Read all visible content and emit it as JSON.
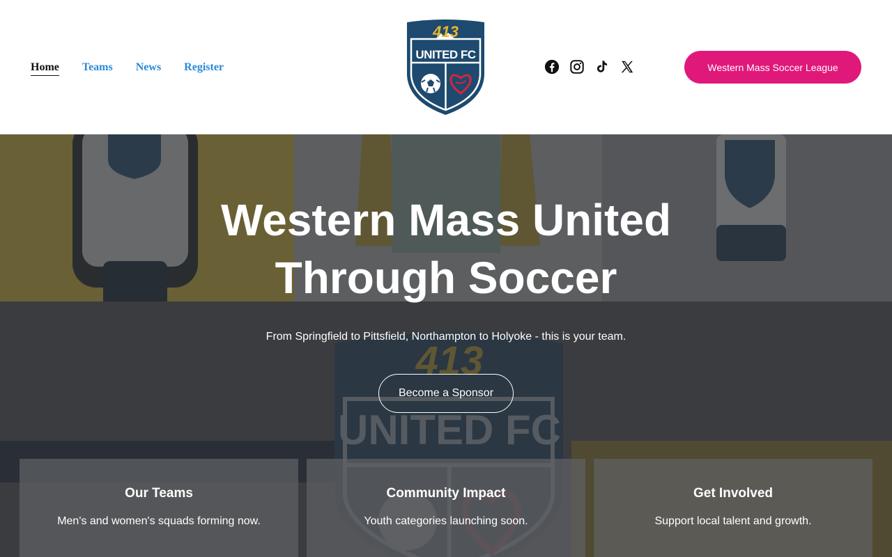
{
  "nav": {
    "items": [
      {
        "label": "Home",
        "active": true
      },
      {
        "label": "Teams",
        "active": false
      },
      {
        "label": "News",
        "active": false
      },
      {
        "label": "Register",
        "active": false
      }
    ]
  },
  "logo": {
    "top_text": "413",
    "main_text": "UNITED FC",
    "colors": {
      "navy": "#1d4a6e",
      "gold": "#e8b62c",
      "red": "#d9243b"
    }
  },
  "social": {
    "icons": [
      "facebook-icon",
      "instagram-icon",
      "tiktok-icon",
      "x-icon"
    ]
  },
  "header_cta": {
    "label": "Western Mass Soccer League",
    "color": "#e0187a"
  },
  "hero": {
    "title": "Western Mass United Through Soccer",
    "subtitle": "From Springfield to Pittsfield, Northampton to Holyoke - this is your team.",
    "button_label": "Become a Sponsor"
  },
  "cards": [
    {
      "title": "Our Teams",
      "text": "Men's and women's squads forming now."
    },
    {
      "title": "Community Impact",
      "text": "Youth categories launching soon."
    },
    {
      "title": "Get Involved",
      "text": "Support local talent and growth."
    }
  ]
}
